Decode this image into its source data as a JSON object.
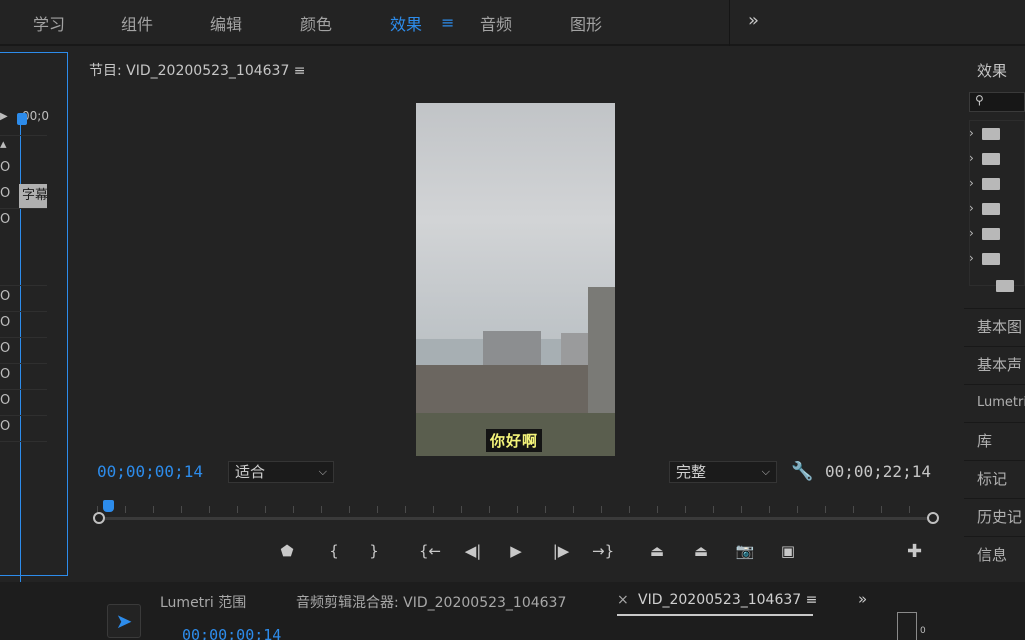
{
  "workspace_tabs": [
    "学习",
    "组件",
    "编辑",
    "颜色",
    "效果",
    "音频",
    "图形"
  ],
  "workspace_active_menu": "≡",
  "workspace_overflow": "»",
  "left_panel": {
    "timecode": "00;0",
    "clip_label": "字幕"
  },
  "program": {
    "title": "节目: VID_20200523_104637 ≡",
    "caption": "你好啊",
    "timecode_current": "00;00;00;14",
    "timecode_duration": "00;00;22;14",
    "fit_dropdown": "适合",
    "quality_dropdown": "完整",
    "playhead_fraction": 0.02
  },
  "controls": [
    "add-marker",
    "mark-in",
    "mark-out",
    "go-to-in",
    "step-back",
    "play",
    "step-forward",
    "go-to-out",
    "lift",
    "extract",
    "export-frame",
    "compare"
  ],
  "effects": {
    "title": "效果",
    "sections": [
      "基本图",
      "基本声",
      "Lumetri",
      "库",
      "标记",
      "历史记",
      "信息"
    ]
  },
  "bottom": {
    "tabs": [
      "Lumetri 范围",
      "音频剪辑混合器: VID_20200523_104637",
      "VID_20200523_104637 ≡"
    ],
    "close": "×",
    "timecode": "00;00;00;14",
    "meter_zero": "0"
  },
  "colors": {
    "accent": "#2d8ceb",
    "caption_text": "#f4f47a"
  }
}
